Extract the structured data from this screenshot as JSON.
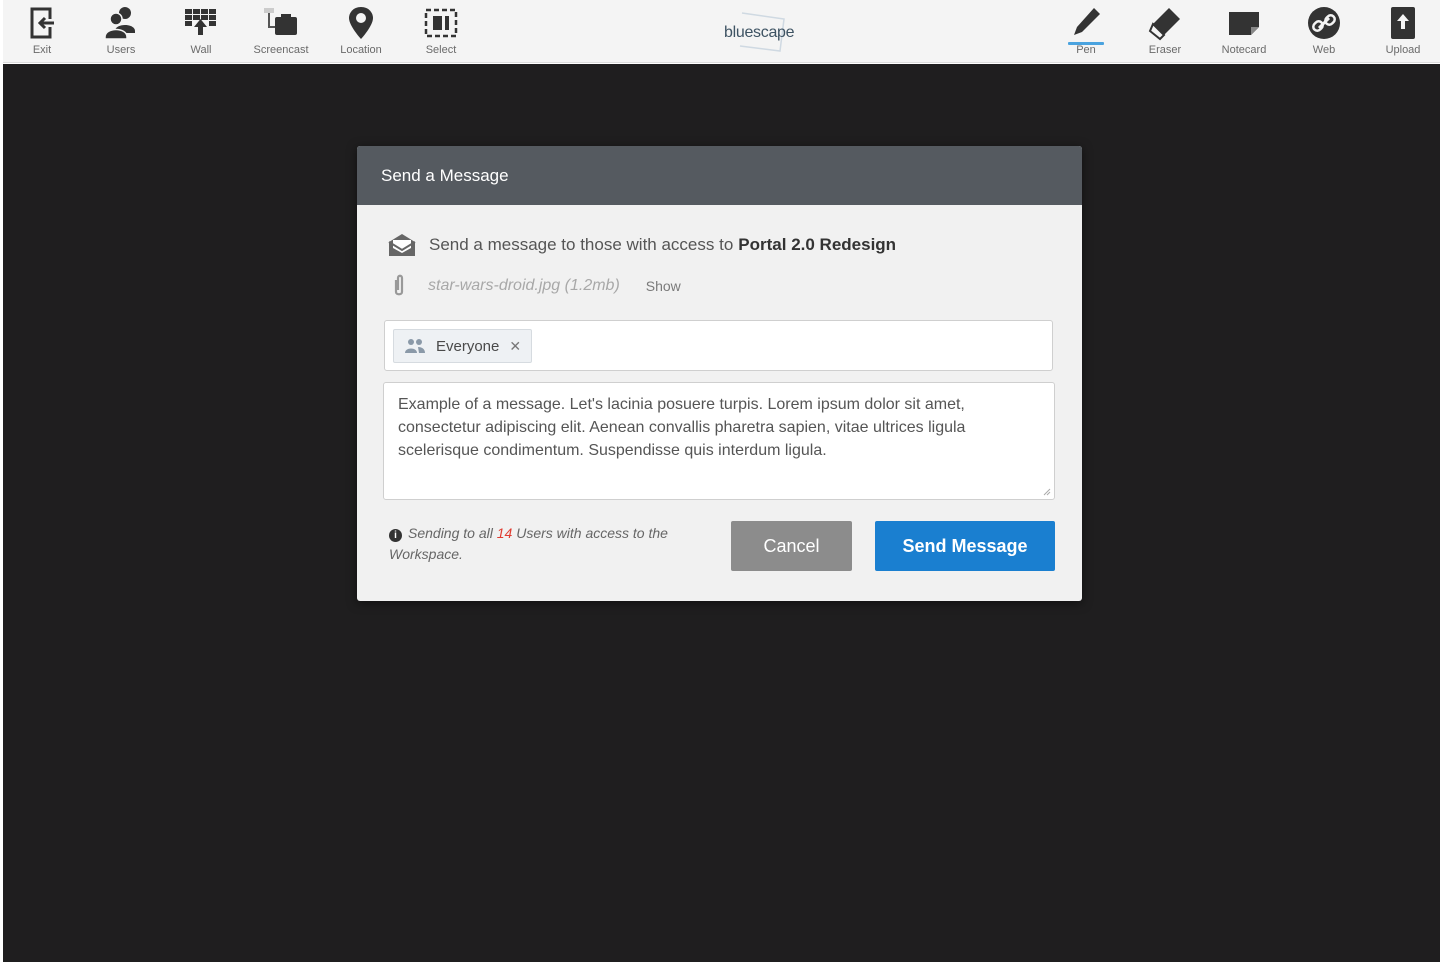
{
  "toolbar": {
    "left_tools": [
      {
        "label": "Exit",
        "icon": "exit-icon"
      },
      {
        "label": "Users",
        "icon": "users-icon"
      },
      {
        "label": "Wall",
        "icon": "wall-icon"
      },
      {
        "label": "Screencast",
        "icon": "screencast-icon"
      },
      {
        "label": "Location",
        "icon": "location-pin-icon"
      },
      {
        "label": "Select",
        "icon": "select-icon"
      }
    ],
    "logo": "bluescape",
    "right_tools": [
      {
        "label": "Pen",
        "icon": "pen-icon"
      },
      {
        "label": "Eraser",
        "icon": "eraser-icon"
      },
      {
        "label": "Notecard",
        "icon": "notecard-icon"
      },
      {
        "label": "Web",
        "icon": "web-link-icon"
      },
      {
        "label": "Upload",
        "icon": "upload-icon"
      }
    ]
  },
  "modal": {
    "title": "Send a Message",
    "intro_text": "Send a message to those with access to",
    "workspace_name": "Portal 2.0 Redesign",
    "attachment": {
      "filename": "star-wars-droid.jpg (1.2mb)",
      "show_label": "Show"
    },
    "recipient_chip": "Everyone",
    "message_body": "Example of a message. Let's lacinia posuere turpis. Lorem ipsum dolor sit amet, consectetur adipiscing elit. Aenean convallis pharetra sapien, vitae ultrices ligula scelerisque condimentum. Suspendisse quis interdum ligula.",
    "note_prefix": "Sending to all",
    "note_count": "14",
    "note_suffix": "Users with access to the Workspace.",
    "cancel_label": "Cancel",
    "send_label": "Send Message"
  },
  "colors": {
    "canvas": "#1f1e1f",
    "header": "#555a60",
    "send_button": "#1a7fd0",
    "cancel_button": "#8c8c8c",
    "count_red": "#e03c31"
  }
}
